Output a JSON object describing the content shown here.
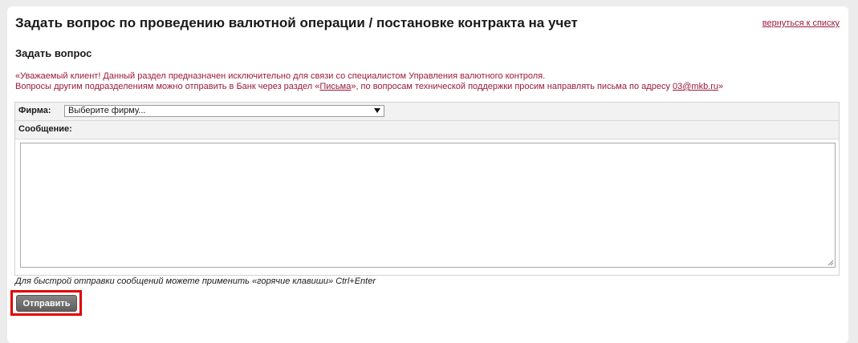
{
  "header": {
    "title": "Задать вопрос по проведению валютной операции / постановке контракта на учет",
    "back_link": "вернуться к списку"
  },
  "section": {
    "title": "Задать вопрос"
  },
  "notice": {
    "line1": "«Уважаемый клиент! Данный раздел предназначен исключительно для связи со специалистом Управления валютного контроля.",
    "line2_before": "Вопросы другим подразделениям можно отправить в Банк через раздел «",
    "line2_link": "Письма",
    "line2_middle": "», по вопросам технической поддержки просим направлять письма по адресу ",
    "line2_email": "03@mkb.ru",
    "line2_after": "»"
  },
  "form": {
    "firm_label": "Фирма:",
    "firm_select_value": "Выберите фирму...",
    "message_label": "Сообщение:",
    "message_value": ""
  },
  "hint": "Для быстрой отправки сообщений можете применить «горячие клавиши» Ctrl+Enter",
  "actions": {
    "send_label": "Отправить"
  },
  "colors": {
    "accent_text": "#9b1a3c",
    "highlight": "#e00000",
    "button": "#6e6e6e"
  },
  "icons": {
    "select_arrow": "chevron-down-icon",
    "resize": "resize-grip-icon"
  }
}
